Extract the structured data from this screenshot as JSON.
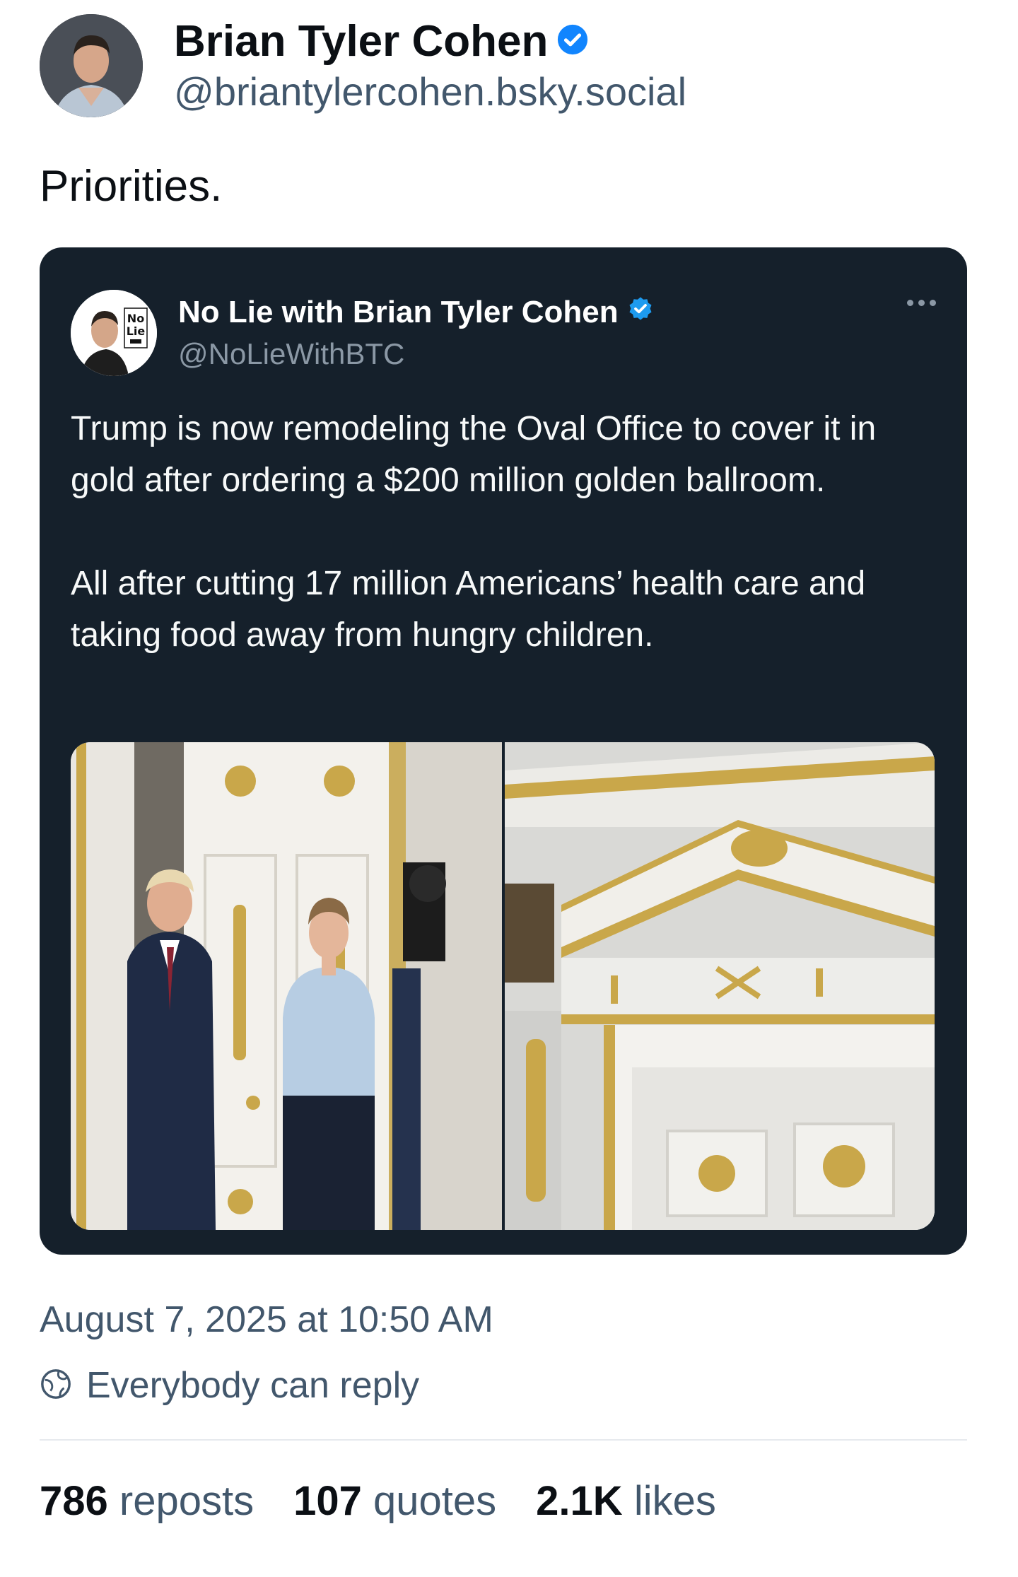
{
  "post": {
    "author": {
      "display_name": "Brian Tyler Cohen",
      "handle": "@briantylercohen.bsky.social",
      "verified": true
    },
    "text": "Priorities.",
    "timestamp": "August 7, 2025 at 10:50 AM",
    "reply_setting": "Everybody can reply",
    "stats": {
      "reposts_count": "786",
      "reposts_label": "reposts",
      "quotes_count": "107",
      "quotes_label": "quotes",
      "likes_count": "2.1K",
      "likes_label": "likes"
    }
  },
  "quote": {
    "author": {
      "display_name": "No Lie with Brian Tyler Cohen",
      "handle": "@NoLieWithBTC",
      "verified": true,
      "avatar_logo_text": "No Lie"
    },
    "paragraph_1": "Trump is now remodeling the Oval Office to cover it in gold after ordering a $200 million golden ballroom.",
    "paragraph_2": "All after cutting 17 million Americans’ health care and taking food away from hungry children.",
    "media": [
      "photo of white door with gold ornaments and people in a doorway",
      "photo of white molding with gilded ornaments"
    ]
  },
  "colors": {
    "verified_blue": "#1185fe",
    "quote_background": "#15202b",
    "secondary_text": "#42576c"
  },
  "icons": [
    "verified-badge-icon",
    "more-options-icon",
    "globe-reply-icon"
  ]
}
